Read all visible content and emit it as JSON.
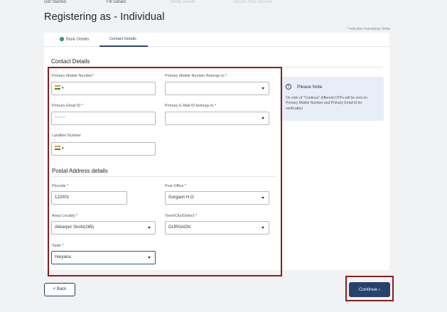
{
  "steps": [
    {
      "label": "Get Started"
    },
    {
      "label": "Fill Details"
    },
    {
      "label": "Verify Details"
    },
    {
      "label": "Secure Your Account"
    }
  ],
  "page_title": "Registering as - Individual",
  "mandatory_note": "* indicates mandatory fields",
  "tabs": [
    {
      "label": "Basic Details",
      "check": "✓"
    },
    {
      "label": "Contact Details"
    }
  ],
  "contact": {
    "section_title": "Contact Details",
    "primary_mobile": {
      "label": "Primary Mobile Number*",
      "prefix": "▾"
    },
    "mobile_belongs": {
      "label": "Primary Mobile Number Belongs to *",
      "value": ""
    },
    "primary_email": {
      "label": "Primary Email ID *",
      "value": "•••••••"
    },
    "email_belongs": {
      "label": "Primary E-Mail ID belongs to *",
      "value": ""
    },
    "landline": {
      "label": "Landline Number",
      "prefix": "▾"
    }
  },
  "postal": {
    "section_title": "Postal Address details",
    "pincode": {
      "label": "Pincode *",
      "value": "122001"
    },
    "post_office": {
      "label": "Post Office *",
      "value": "Gurgaon H.O"
    },
    "area": {
      "label": "Area/ Locality *",
      "value": "Akbarpur Sirohi(265)"
    },
    "town": {
      "label": "Town/City/District *",
      "value": "GURGAON"
    },
    "state": {
      "label": "State *",
      "value": "Haryana"
    }
  },
  "note": {
    "icon": "i",
    "title": "Please Note",
    "body": "On click of \"Continue\" different OTPs will be sent on Primary Mobile Number and Primary Email id for verification"
  },
  "buttons": {
    "back": "< Back",
    "continue": "Continue ›"
  },
  "colors": {
    "primary": "#27426b",
    "highlight_box": "#8b1c1c",
    "note_bg": "#e7eef8",
    "completed_check": "#2e8b57"
  }
}
